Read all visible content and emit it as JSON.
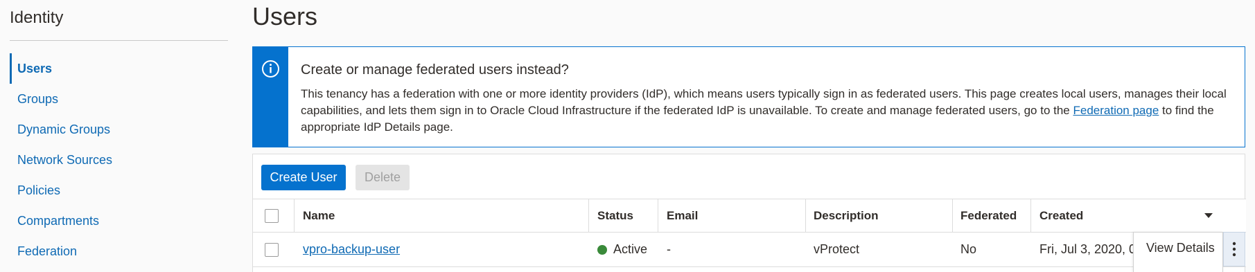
{
  "sidebar": {
    "title": "Identity",
    "items": [
      {
        "label": "Users",
        "active": true
      },
      {
        "label": "Groups"
      },
      {
        "label": "Dynamic Groups"
      },
      {
        "label": "Network Sources"
      },
      {
        "label": "Policies"
      },
      {
        "label": "Compartments"
      },
      {
        "label": "Federation"
      }
    ]
  },
  "page": {
    "title": "Users"
  },
  "info_banner": {
    "icon": "info-icon",
    "heading": "Create or manage federated users instead?",
    "text_before_link": "This tenancy has a federation with one or more identity providers (IdP), which means users typically sign in as federated users. This page creates local users, manages their local capabilities, and lets them sign in to Oracle Cloud Infrastructure if the federated IdP is unavailable. To create and manage federated users, go to the ",
    "link_text": "Federation page",
    "text_after_link": " to find the appropriate IdP Details page.",
    "accent_color": "#0572ce"
  },
  "toolbar": {
    "create_label": "Create User",
    "delete_label": "Delete"
  },
  "table": {
    "columns": [
      "Name",
      "Status",
      "Email",
      "Description",
      "Federated",
      "Created"
    ],
    "rows": [
      {
        "name": "vpro-backup-user",
        "status": "Active",
        "email": "-",
        "description": "vProtect",
        "federated": "No",
        "created": "Fri, Jul 3, 2020, 0"
      }
    ]
  },
  "action_menu": {
    "items": [
      "View Details"
    ]
  }
}
